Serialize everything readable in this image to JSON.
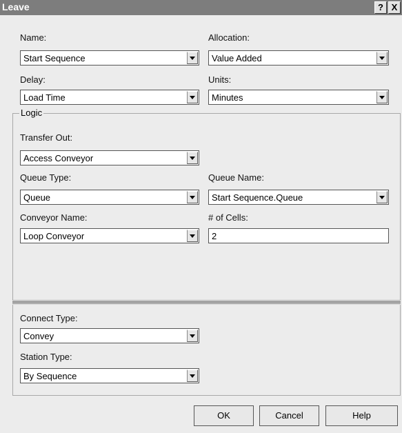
{
  "window": {
    "title": "Leave",
    "help_button": "?",
    "close_button": "X"
  },
  "labels": {
    "name": "Name:",
    "allocation": "Allocation:",
    "delay": "Delay:",
    "units": "Units:",
    "logic": "Logic",
    "transfer_out": "Transfer Out:",
    "queue_type": "Queue Type:",
    "queue_name": "Queue Name:",
    "conveyor_name": "Conveyor Name:",
    "num_cells": "# of Cells:",
    "connect_type": "Connect Type:",
    "station_type": "Station Type:"
  },
  "values": {
    "name": "Start Sequence",
    "allocation": "Value Added",
    "delay": "Load Time",
    "units": "Minutes",
    "transfer_out": "Access Conveyor",
    "queue_type": "Queue",
    "queue_name": "Start Sequence.Queue",
    "conveyor_name": "Loop Conveyor",
    "num_cells": "2",
    "connect_type": "Convey",
    "station_type": "By Sequence"
  },
  "buttons": {
    "ok": "OK",
    "cancel": "Cancel",
    "help": "Help"
  }
}
